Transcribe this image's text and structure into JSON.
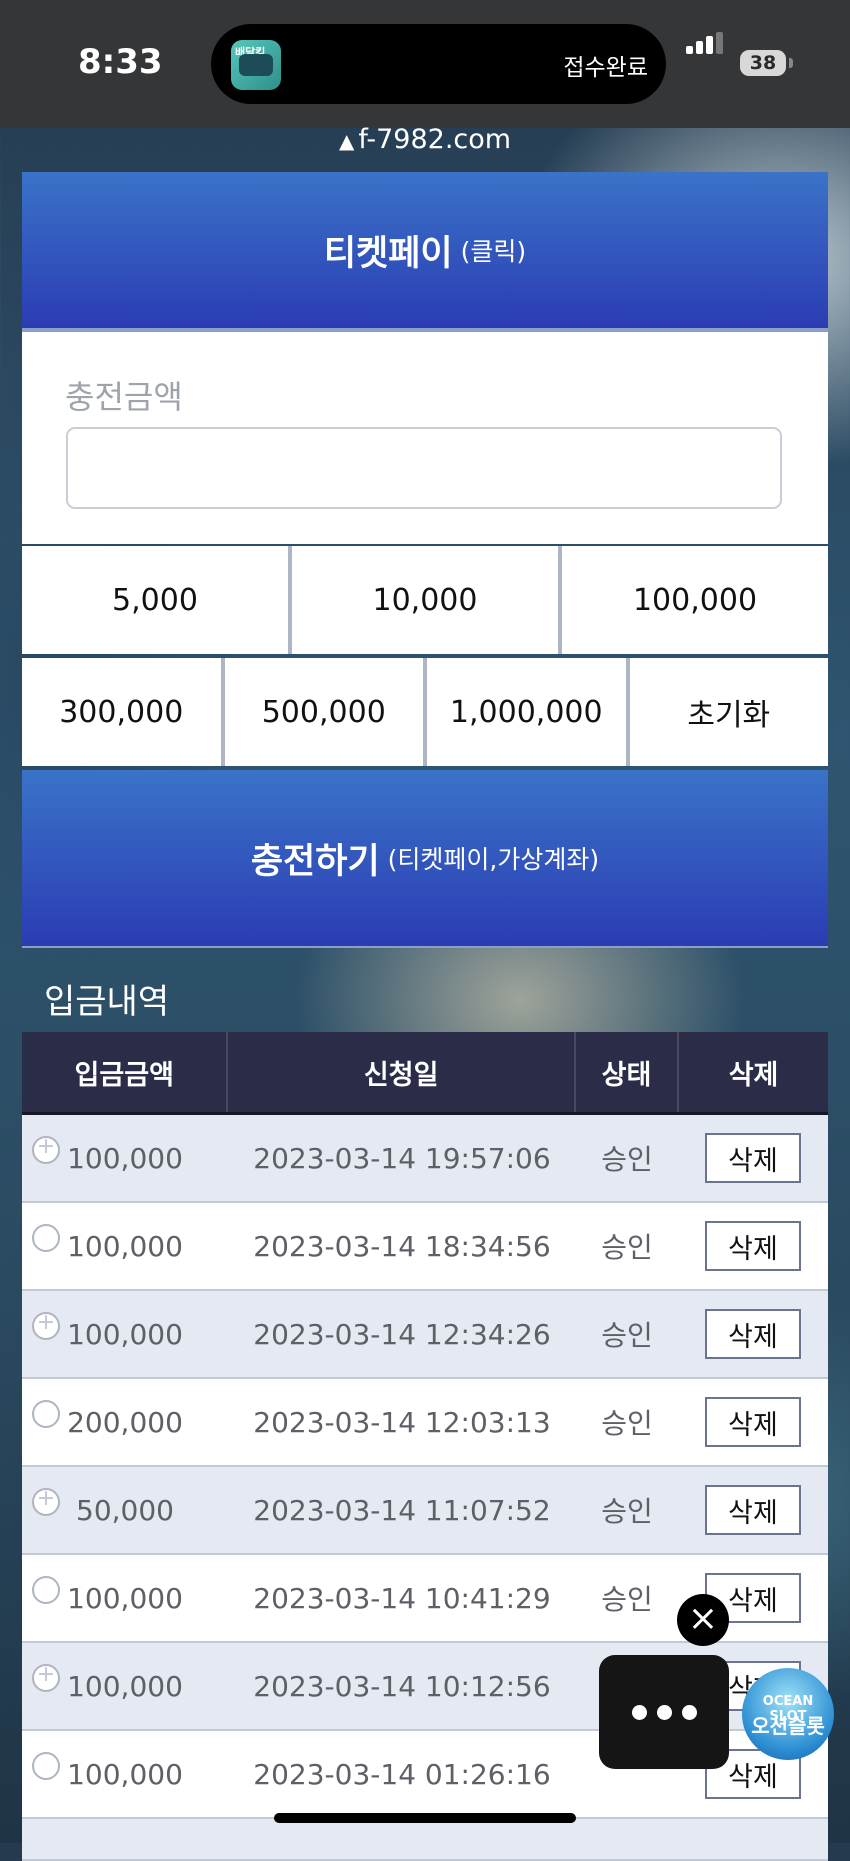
{
  "status_bar": {
    "time": "8:33",
    "island_text": "접수완료",
    "battery": "38",
    "app_icon_label": "배달킹"
  },
  "browser": {
    "url": "f-7982.com"
  },
  "ticket_header": {
    "title": "티켓페이",
    "sub": "(클릭)"
  },
  "charge_form": {
    "amount_label": "충전금액",
    "amount_value": "",
    "amounts_row1": [
      "5,000",
      "10,000",
      "100,000"
    ],
    "amounts_row2": [
      "300,000",
      "500,000",
      "1,000,000"
    ],
    "reset_label": "초기화",
    "submit_label": "충전하기",
    "submit_sub": "(티켓페이,가상계좌)"
  },
  "history": {
    "title": "입금내역",
    "columns": [
      "입금금액",
      "신청일",
      "상태",
      "삭제"
    ],
    "rows": [
      {
        "amount": "100,000",
        "date": "2023-03-14 19:57:06",
        "status": "승인",
        "delete": "삭제"
      },
      {
        "amount": "100,000",
        "date": "2023-03-14 18:34:56",
        "status": "승인",
        "delete": "삭제"
      },
      {
        "amount": "100,000",
        "date": "2023-03-14 12:34:26",
        "status": "승인",
        "delete": "삭제"
      },
      {
        "amount": "200,000",
        "date": "2023-03-14 12:03:13",
        "status": "승인",
        "delete": "삭제"
      },
      {
        "amount": "50,000",
        "date": "2023-03-14 11:07:52",
        "status": "승인",
        "delete": "삭제"
      },
      {
        "amount": "100,000",
        "date": "2023-03-14 10:41:29",
        "status": "승인",
        "delete": "삭제"
      },
      {
        "amount": "100,000",
        "date": "2023-03-14 10:12:56",
        "status": "",
        "delete": "삭제"
      },
      {
        "amount": "100,000",
        "date": "2023-03-14 01:26:16",
        "status": "",
        "delete": "삭제"
      }
    ]
  },
  "overlay": {
    "close_icon": "close-icon",
    "more_icon": "more-dots-icon",
    "logo_line1": "OCEAN SLOT",
    "logo_line2": "오션슬롯"
  },
  "colors": {
    "header_gradient_top": "#3a73c8",
    "header_gradient_bottom": "#2b3cb3",
    "table_header": "#2a2c48",
    "row_odd": "#e5e9f1"
  }
}
